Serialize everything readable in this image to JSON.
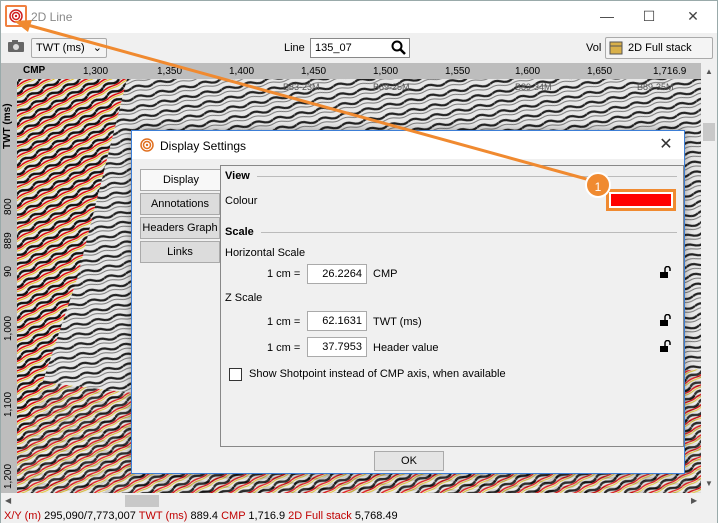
{
  "window": {
    "title": "2D Line"
  },
  "toolbar": {
    "domain_select": "TWT (ms)",
    "line_label": "Line",
    "line_value": "135_07",
    "vol_label": "Vol",
    "vol_value": "2D Full stack"
  },
  "axes": {
    "top_label": "CMP",
    "top_ticks": [
      "1,300",
      "1,350",
      "1,400",
      "1,450",
      "1,500",
      "1,550",
      "1,600",
      "1,650",
      "1,716.9"
    ],
    "left_label": "TWT (ms)",
    "left_ticks": [
      "800",
      "889",
      "90",
      "1,000",
      "1,100",
      "1,200"
    ],
    "annotations": [
      "B83-23M",
      "B89-25M",
      "B89-34M",
      "B89-35M"
    ]
  },
  "status": {
    "xy_label": "X/Y (m)",
    "xy_value": "295,090/7,773,007",
    "twt_label": "TWT (ms)",
    "twt_value": "889.4",
    "cmp_label": "CMP",
    "cmp_value": "1,716.9",
    "stack_label": "2D Full stack",
    "stack_value": "5,768.49"
  },
  "dialog": {
    "title": "Display Settings",
    "tabs": [
      "Display",
      "Annotations",
      "Headers Graph",
      "Links"
    ],
    "view_section": "View",
    "colour_label": "Colour",
    "colour_value": "#ff0000",
    "scale_section": "Scale",
    "hscale_label": "Horizontal Scale",
    "zscale_label": "Z Scale",
    "rows": [
      {
        "prefix": "1 cm =",
        "value": "26.2264",
        "unit": "CMP"
      },
      {
        "prefix": "1 cm =",
        "value": "62.1631",
        "unit": "TWT (ms)"
      },
      {
        "prefix": "1 cm =",
        "value": "37.7953",
        "unit": "Header value"
      }
    ],
    "checkbox_label": "Show Shotpoint instead of CMP axis, when available",
    "ok_label": "OK"
  },
  "callout": {
    "number": "1"
  },
  "colors": {
    "accent": "#f08a30",
    "selection": "#ff0000"
  }
}
